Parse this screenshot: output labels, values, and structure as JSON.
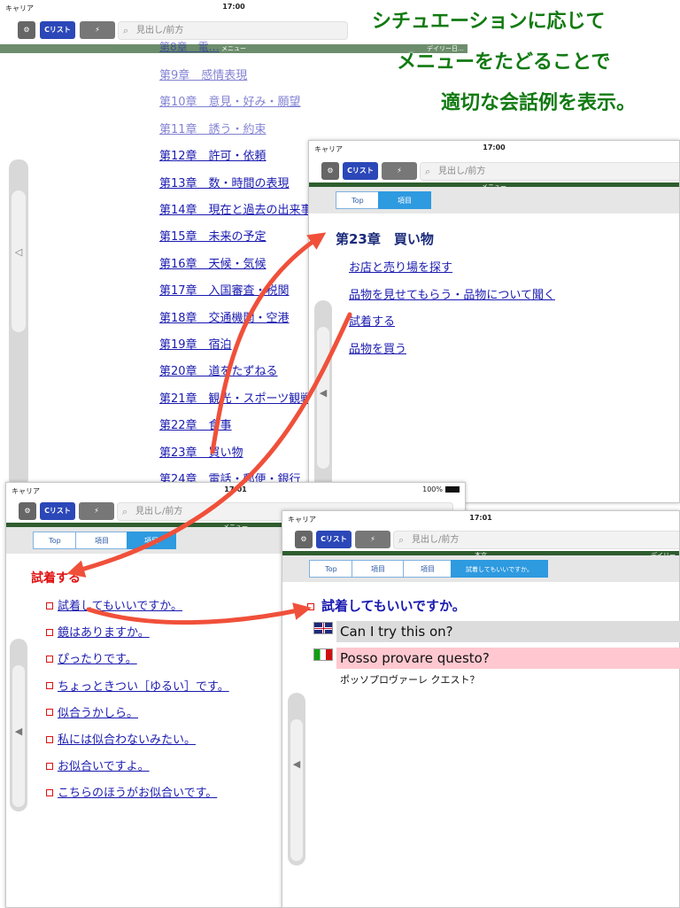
{
  "caption": {
    "line1": "シチュエーションに応じて",
    "line2": "メニューをたどることで",
    "line3": "適切な会話例を表示。"
  },
  "colors": {
    "caption_green": "#117a11",
    "arrow_red": "#f0503a",
    "header_green": "#2f5d2f",
    "crumb_blue": "#2e9ae0",
    "link_blue": "#1a1ab0",
    "item_red": "#e01010",
    "italian_row": "#ffc8d0"
  },
  "panel1": {
    "status_left": "キャリア",
    "time": "17:00",
    "list_label": "Cリスト",
    "search_placeholder": "見出し/前方",
    "greenbar": "メニュー",
    "greenbar_right": "デイリー日…",
    "partial_top": "第8章　電…",
    "chapters": [
      "第9章　感情表現",
      "第10章　意見・好み・願望",
      "第11章　誘う・約束",
      "第12章　許可・依頼",
      "第13章　数・時間の表現",
      "第14章　現在と過去の出来事",
      "第15章　未来の予定",
      "第16章　天候・気候",
      "第17章　入国審査・税関",
      "第18章　交通機関・空港",
      "第19章　宿泊",
      "第20章　道をたずねる",
      "第21章　観光・スポーツ観戦",
      "第22章　食事",
      "第23章　買い物",
      "第24章　電話・郵便・銀行"
    ]
  },
  "panel2": {
    "status_left": "キャリア",
    "time": "17:00",
    "list_label": "Cリスト",
    "search_placeholder": "見出し/前方",
    "greenbar": "メニュー",
    "crumbs": [
      "Top",
      "項目"
    ],
    "heading": "第23章　買い物",
    "items": [
      "お店と売り場を探す",
      "品物を見せてもらう・品物について聞く",
      "試着する",
      "品物を買う"
    ]
  },
  "panel3": {
    "status_left": "キャリア",
    "time": "17:01",
    "battery": "100%",
    "list_label": "Cリスト",
    "search_placeholder": "見出し/前方",
    "greenbar": "メニュー",
    "crumbs": [
      "Top",
      "項目",
      "項目"
    ],
    "title": "試着する",
    "items": [
      "試着してもいいですか。",
      "鏡はありますか。",
      "ぴったりです。",
      "ちょっときつい［ゆるい］です。",
      "似合うかしら。",
      "私には似合わないみたい。",
      "お似合いですよ。",
      "こちらのほうがお似合いです。"
    ]
  },
  "panel4": {
    "status_left": "キャリア",
    "time": "17:01",
    "list_label": "Cリスト",
    "search_placeholder": "見出し/前方",
    "greenbar": "本文",
    "greenbar_right": "デイリー",
    "crumbs": [
      "Top",
      "項目",
      "項目",
      "試着してもいいですか。"
    ],
    "sentence": "試着してもいいですか。",
    "english": "Can I try this on?",
    "italian": "Posso provare questo?",
    "reading": "ポッソプロヴァーレ クエスト？"
  }
}
